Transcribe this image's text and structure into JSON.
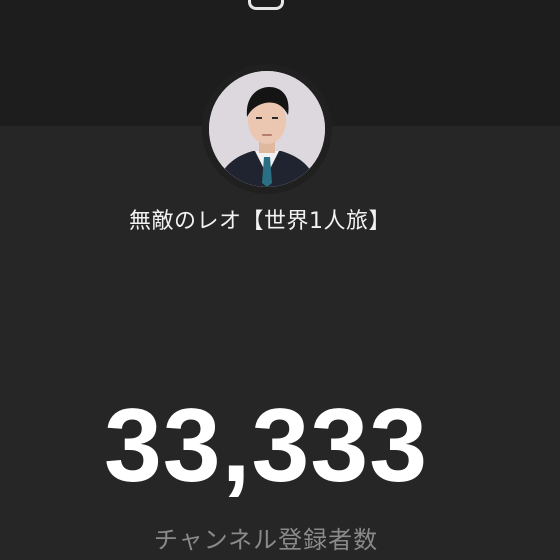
{
  "header": {
    "top_icon": "share-icon"
  },
  "channel": {
    "name": "無敵のレオ【世界1人旅】",
    "avatar_icon": "channel-avatar"
  },
  "subscribers": {
    "count": "33,333",
    "label": "チャンネル登録者数"
  },
  "colors": {
    "background": "#262626",
    "banner": "#1d1d1d",
    "count_text": "#ffffff",
    "label_text": "#8a8a8a"
  }
}
